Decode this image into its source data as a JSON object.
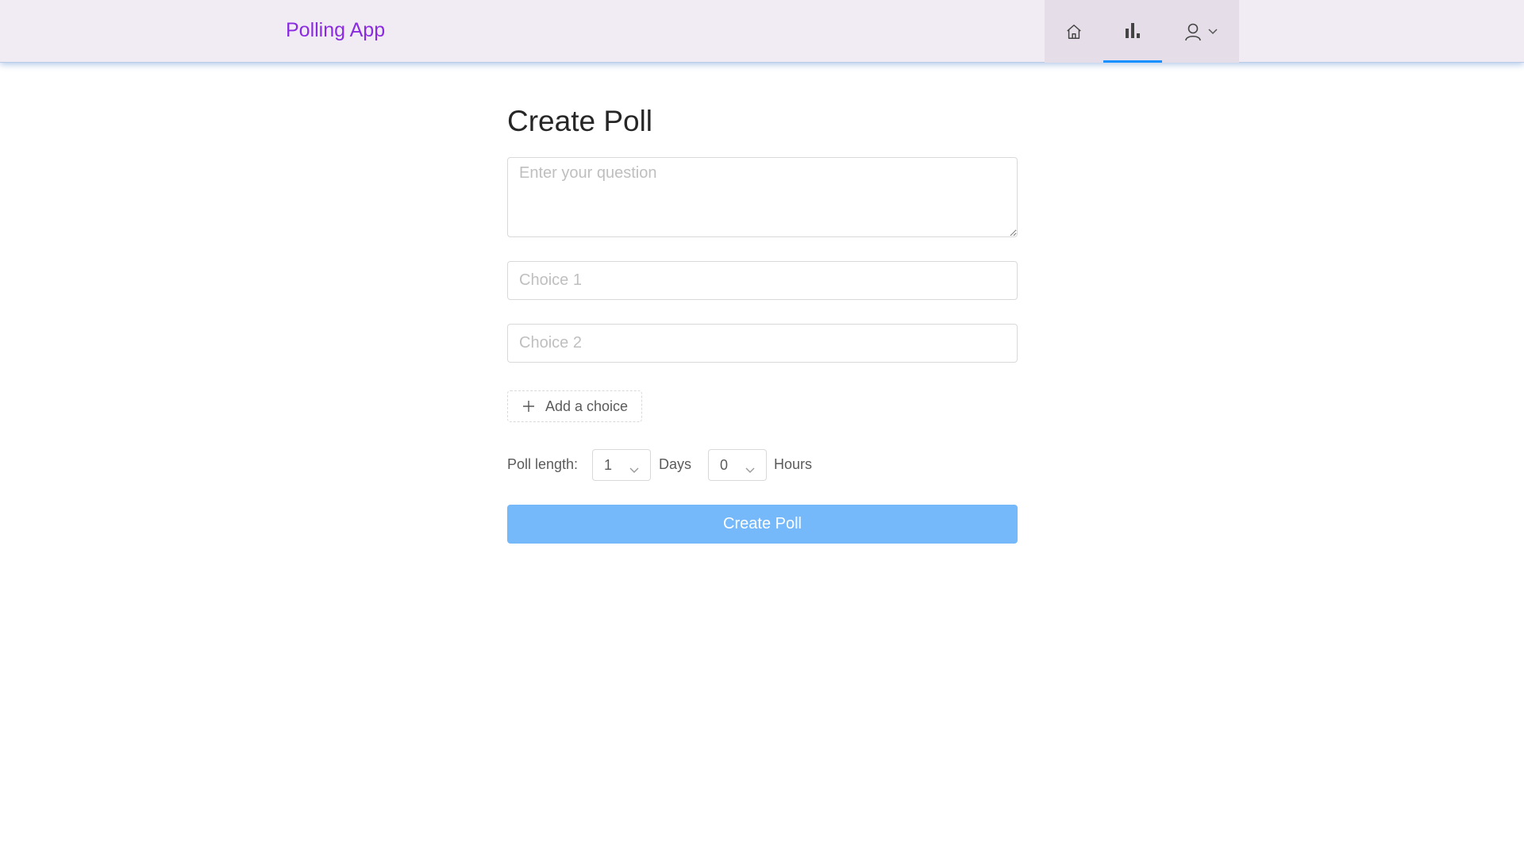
{
  "header": {
    "brand": "Polling App",
    "nav": [
      {
        "name": "home",
        "icon": "home-icon"
      },
      {
        "name": "new-poll",
        "icon": "bar-chart-icon",
        "active": true
      },
      {
        "name": "profile",
        "icon": "user-icon"
      }
    ],
    "accent_color": "#1890ff",
    "brand_color": "#8a2be2"
  },
  "form": {
    "title": "Create Poll",
    "question_placeholder": "Enter your question",
    "question_value": "",
    "choices": [
      {
        "placeholder": "Choice 1",
        "value": ""
      },
      {
        "placeholder": "Choice 2",
        "value": ""
      }
    ],
    "add_choice_label": "Add a choice",
    "poll_length": {
      "label": "Poll length:",
      "days_value": "1",
      "days_label": "Days",
      "hours_value": "0",
      "hours_label": "Hours"
    },
    "submit_label": "Create Poll",
    "submit_color": "#75b9fb"
  }
}
